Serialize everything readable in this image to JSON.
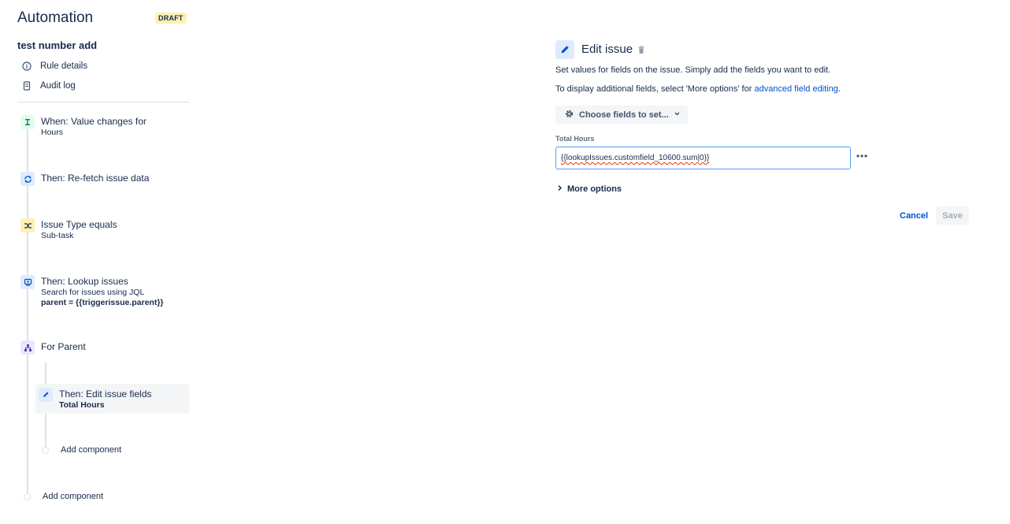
{
  "header": {
    "app_title": "Automation",
    "status_badge": "DRAFT",
    "rule_name": "test number add"
  },
  "sidebar": {
    "nav": [
      {
        "label": "Rule details",
        "icon": "info-circle-icon"
      },
      {
        "label": "Audit log",
        "icon": "document-icon"
      }
    ],
    "steps": [
      {
        "title": "When: Value changes for",
        "sub": "Hours",
        "icon": "trigger-icon",
        "color": "#e3fcef"
      },
      {
        "title": "Then: Re-fetch issue data",
        "sub": "",
        "icon": "refresh-icon",
        "color": "#deebff"
      },
      {
        "title": "Issue Type equals",
        "sub": "Sub-task",
        "icon": "condition-icon",
        "color": "#fff0b3"
      },
      {
        "title": "Then: Lookup issues",
        "sub": "Search for issues using JQL",
        "sub2": "parent = {{triggerissue.parent}}",
        "icon": "lookup-icon",
        "color": "#deebff"
      },
      {
        "title": "For Parent",
        "sub": "",
        "icon": "branch-icon",
        "color": "#eae6ff"
      },
      {
        "title": "Then: Edit issue fields",
        "sub": "Total Hours",
        "icon": "edit-icon",
        "color": "#deebff"
      }
    ],
    "add_component_inner": "Add component",
    "add_component_outer": "Add component"
  },
  "panel": {
    "title": "Edit issue",
    "description": "Set values for fields on the issue. Simply add the fields you want to edit.",
    "more_text": "To display additional fields, select 'More options' for ",
    "more_link": "advanced field editing",
    "more_suffix": ".",
    "choose_fields": "Choose fields to set...",
    "field_label": "Total Hours",
    "field_value": "{{lookupIssues.customfield_10600.sum|0}}",
    "more_options": "More options",
    "cancel": "Cancel",
    "save": "Save"
  }
}
